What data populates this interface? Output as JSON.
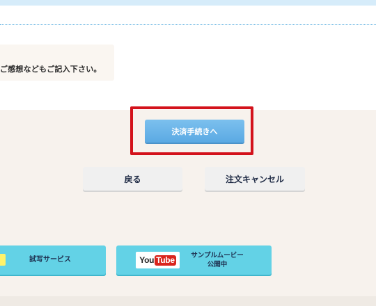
{
  "colors": {
    "top_band": "#d6ecfa",
    "divider": "#5aaee0",
    "beige_bg": "#f7f2ed",
    "highlight_frame": "#d3121b",
    "primary_button": "#68b4e8",
    "secondary_button": "#f0f0f0",
    "banner": "#63d2e6",
    "youtube_red": "#d9251d"
  },
  "note": {
    "text": "ご感想などもご記入下さい。"
  },
  "actions": {
    "proceed_to_payment": "決済手続きへ",
    "back": "戻る",
    "cancel_order": "注文キャンセル"
  },
  "banners": {
    "trial": {
      "label": "試写サービス",
      "icon": "trial-service-icon"
    },
    "youtube": {
      "logo_you": "You",
      "logo_tube": "Tube",
      "line1": "サンプルムービー",
      "line2": "公開中",
      "icon": "youtube-logo"
    }
  }
}
